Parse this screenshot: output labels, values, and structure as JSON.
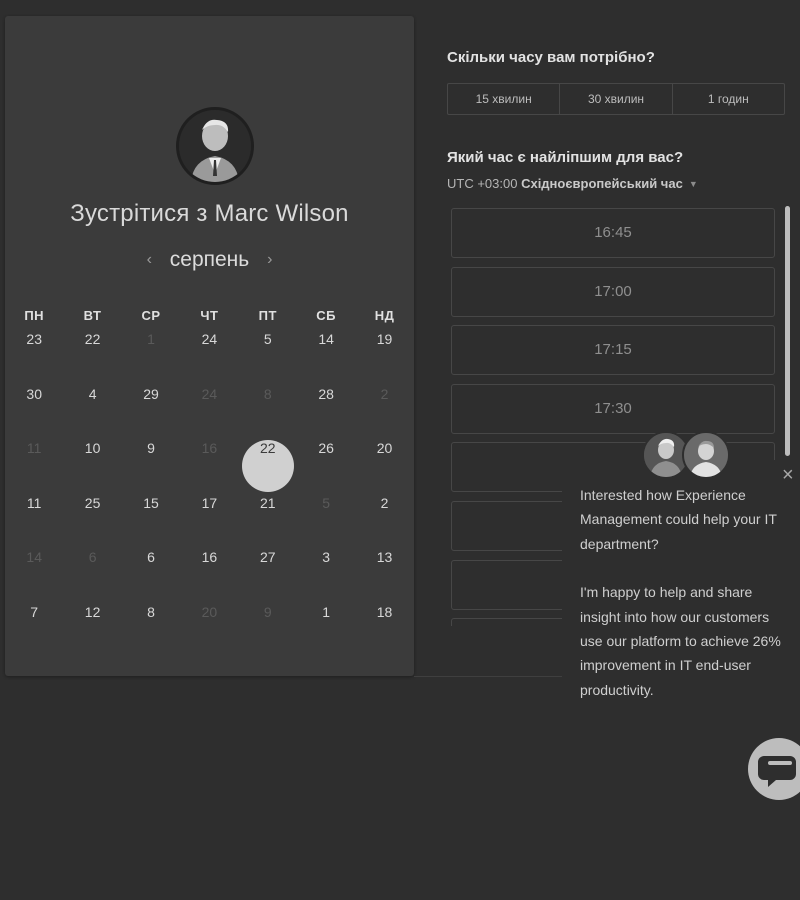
{
  "calendar": {
    "title": "Зустрітися з Marc Wilson",
    "month": "серпень",
    "prev_icon": "‹",
    "next_icon": "›",
    "weekdays": [
      "ПН",
      "ВТ",
      "СР",
      "ЧТ",
      "ПТ",
      "СБ",
      "НД"
    ],
    "weeks": [
      [
        {
          "d": "23"
        },
        {
          "d": "22"
        },
        {
          "d": "1",
          "dim": true
        },
        {
          "d": "24"
        },
        {
          "d": "5"
        },
        {
          "d": "14"
        },
        {
          "d": "19"
        }
      ],
      [
        {
          "d": "30"
        },
        {
          "d": "4"
        },
        {
          "d": "29"
        },
        {
          "d": "24",
          "dim": true
        },
        {
          "d": "8",
          "dim": true
        },
        {
          "d": "28"
        },
        {
          "d": "2",
          "dim": true
        }
      ],
      [
        {
          "d": "11",
          "dim": true
        },
        {
          "d": "10"
        },
        {
          "d": "9"
        },
        {
          "d": "16",
          "dim": true
        },
        {
          "d": "22",
          "selected": true
        },
        {
          "d": "26"
        },
        {
          "d": "20"
        }
      ],
      [
        {
          "d": "11"
        },
        {
          "d": "25"
        },
        {
          "d": "15"
        },
        {
          "d": "17"
        },
        {
          "d": "21"
        },
        {
          "d": "5",
          "dim": true
        },
        {
          "d": "2"
        }
      ],
      [
        {
          "d": "14",
          "dim": true
        },
        {
          "d": "6",
          "dim": true
        },
        {
          "d": "6"
        },
        {
          "d": "16"
        },
        {
          "d": "27"
        },
        {
          "d": "3"
        },
        {
          "d": "13"
        }
      ],
      [
        {
          "d": "7"
        },
        {
          "d": "12"
        },
        {
          "d": "8"
        },
        {
          "d": "20",
          "dim": true
        },
        {
          "d": "9",
          "dim": true
        },
        {
          "d": "1"
        },
        {
          "d": "18"
        }
      ]
    ]
  },
  "booking": {
    "duration_question": "Скільки часу вам потрібно?",
    "durations": [
      "15 хвилин",
      "30 хвилин",
      "1 годин"
    ],
    "time_question": "Який час є найліпшим для вас?",
    "tz_prefix": "UTC +03:00",
    "tz_name": "Східноєвропейський час",
    "slots": [
      "16:45",
      "17:00",
      "17:15",
      "17:30",
      "",
      "",
      "",
      ""
    ]
  },
  "popup": {
    "close_icon": "×",
    "paragraph1": "Interested how Experience Management could help your IT department?",
    "paragraph2": "I'm happy to help and share insight into how our customers use our platform to achieve 26% improvement in IT end-user productivity."
  },
  "colors": {
    "background": "#2e2e2e",
    "panel": "#3b3b3b",
    "selected_day": "#d0d0d0",
    "chat_button": "#bdbdbd"
  },
  "icons": {
    "chat": "chat-bubble-icon",
    "close": "close-icon",
    "caret": "caret-down-icon"
  }
}
